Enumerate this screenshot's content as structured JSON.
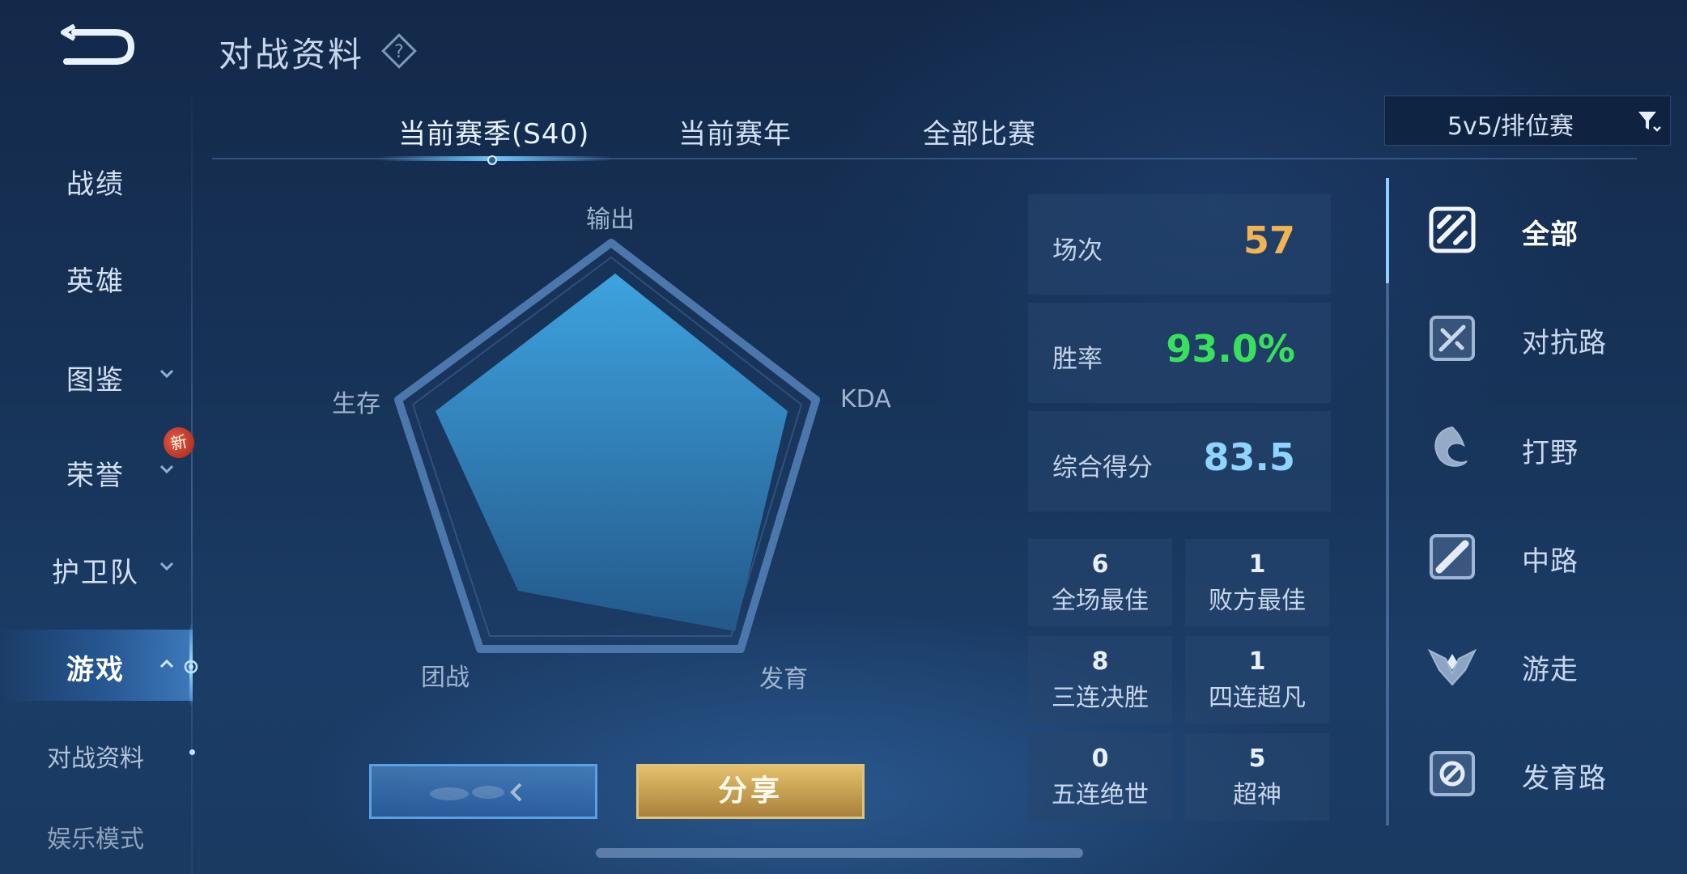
{
  "header": {
    "title": "对战资料",
    "help_icon": "question-diamond-icon",
    "back_icon": "back-arrow-icon"
  },
  "sidebar": {
    "items": [
      {
        "label": "战绩",
        "has_chevron": false
      },
      {
        "label": "英雄",
        "has_chevron": false
      },
      {
        "label": "图鉴",
        "has_chevron": true
      },
      {
        "label": "荣誉",
        "has_chevron": true,
        "badge": "新"
      },
      {
        "label": "护卫队",
        "has_chevron": true
      },
      {
        "label": "游戏",
        "has_chevron": true,
        "expanded": true,
        "active": true
      }
    ],
    "sub_items": [
      {
        "label": "对战资料",
        "active": true
      },
      {
        "label": "娱乐模式",
        "active": false
      }
    ]
  },
  "tabs": [
    {
      "label": "当前赛季(S40)",
      "active": true
    },
    {
      "label": "当前赛年",
      "active": false
    },
    {
      "label": "全部比赛",
      "active": false
    }
  ],
  "mode_select": {
    "value": "5v5/排位赛",
    "icon": "filter-icon"
  },
  "radar": {
    "labels": {
      "top": "输出",
      "right": "KDA",
      "bottom_right": "发育",
      "bottom_left": "团战",
      "left": "生存"
    }
  },
  "stats": {
    "matches": {
      "label": "场次",
      "value": "57",
      "color": "#f2b451"
    },
    "win_rate": {
      "label": "胜率",
      "value": "93.0%",
      "color": "#39e05a"
    },
    "score": {
      "label": "综合得分",
      "value": "83.5",
      "color": "#8fd3ff"
    }
  },
  "achievements": [
    {
      "count": "6",
      "label": "全场最佳"
    },
    {
      "count": "1",
      "label": "败方最佳"
    },
    {
      "count": "8",
      "label": "三连决胜"
    },
    {
      "count": "1",
      "label": "四连超凡"
    },
    {
      "count": "0",
      "label": "五连绝世"
    },
    {
      "count": "5",
      "label": "超神"
    }
  ],
  "positions": [
    {
      "label": "全部",
      "icon": "all-positions-icon",
      "active": true
    },
    {
      "label": "对抗路",
      "icon": "clash-lane-icon",
      "active": false
    },
    {
      "label": "打野",
      "icon": "jungle-icon",
      "active": false
    },
    {
      "label": "中路",
      "icon": "mid-lane-icon",
      "active": false
    },
    {
      "label": "游走",
      "icon": "roam-icon",
      "active": false
    },
    {
      "label": "发育路",
      "icon": "farm-lane-icon",
      "active": false
    }
  ],
  "buttons": {
    "share": "分享"
  },
  "colors": {
    "accent": "#6fc6ff",
    "gold": "#e3c06c"
  }
}
